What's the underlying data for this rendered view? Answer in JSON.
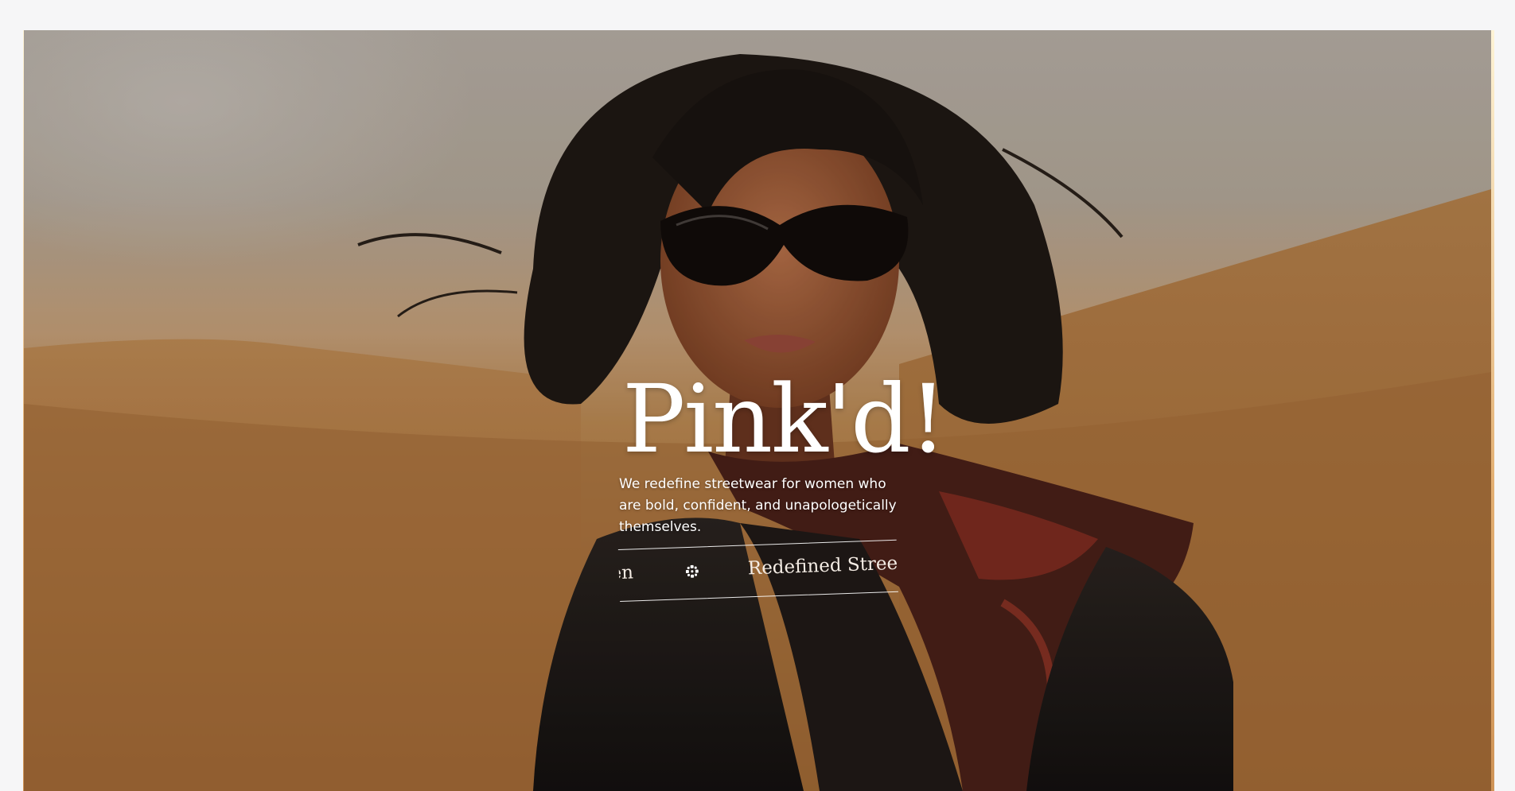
{
  "hero": {
    "brand": "Pink'd!",
    "tagline": "We redefine streetwear for women who are bold, confident, and unapologetically themselves.",
    "marquee": {
      "items": [
        "omen",
        "Redefined Stree"
      ],
      "separator_icon": "sparkle-icon"
    },
    "photo_description_icon": "hero-photo"
  },
  "colors": {
    "page_background": "#f6f6f7",
    "text": "#ffffff",
    "sand": "#b07a44"
  }
}
